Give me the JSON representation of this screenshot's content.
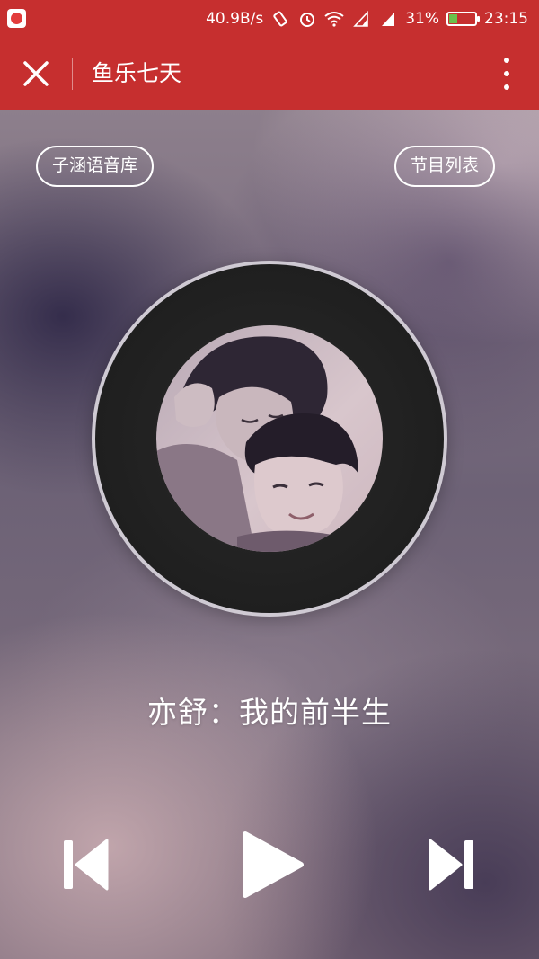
{
  "status_bar": {
    "network_speed": "40.9B/s",
    "battery_percent": "31%",
    "battery_level": 0.31,
    "time": "23:15",
    "icons": [
      "netease-music-icon",
      "vibrate-icon",
      "alarm-icon",
      "wifi-icon",
      "signal-icon",
      "signal-icon",
      "battery-icon"
    ]
  },
  "app_bar": {
    "title": "鱼乐七天",
    "background_color": "#c62f2f"
  },
  "player": {
    "library_label": "子涵语音库",
    "programs_label": "节目列表",
    "track_title": "亦舒：我的前半生"
  },
  "controls": {
    "icons": [
      "previous-track-icon",
      "play-icon",
      "next-track-icon"
    ]
  }
}
